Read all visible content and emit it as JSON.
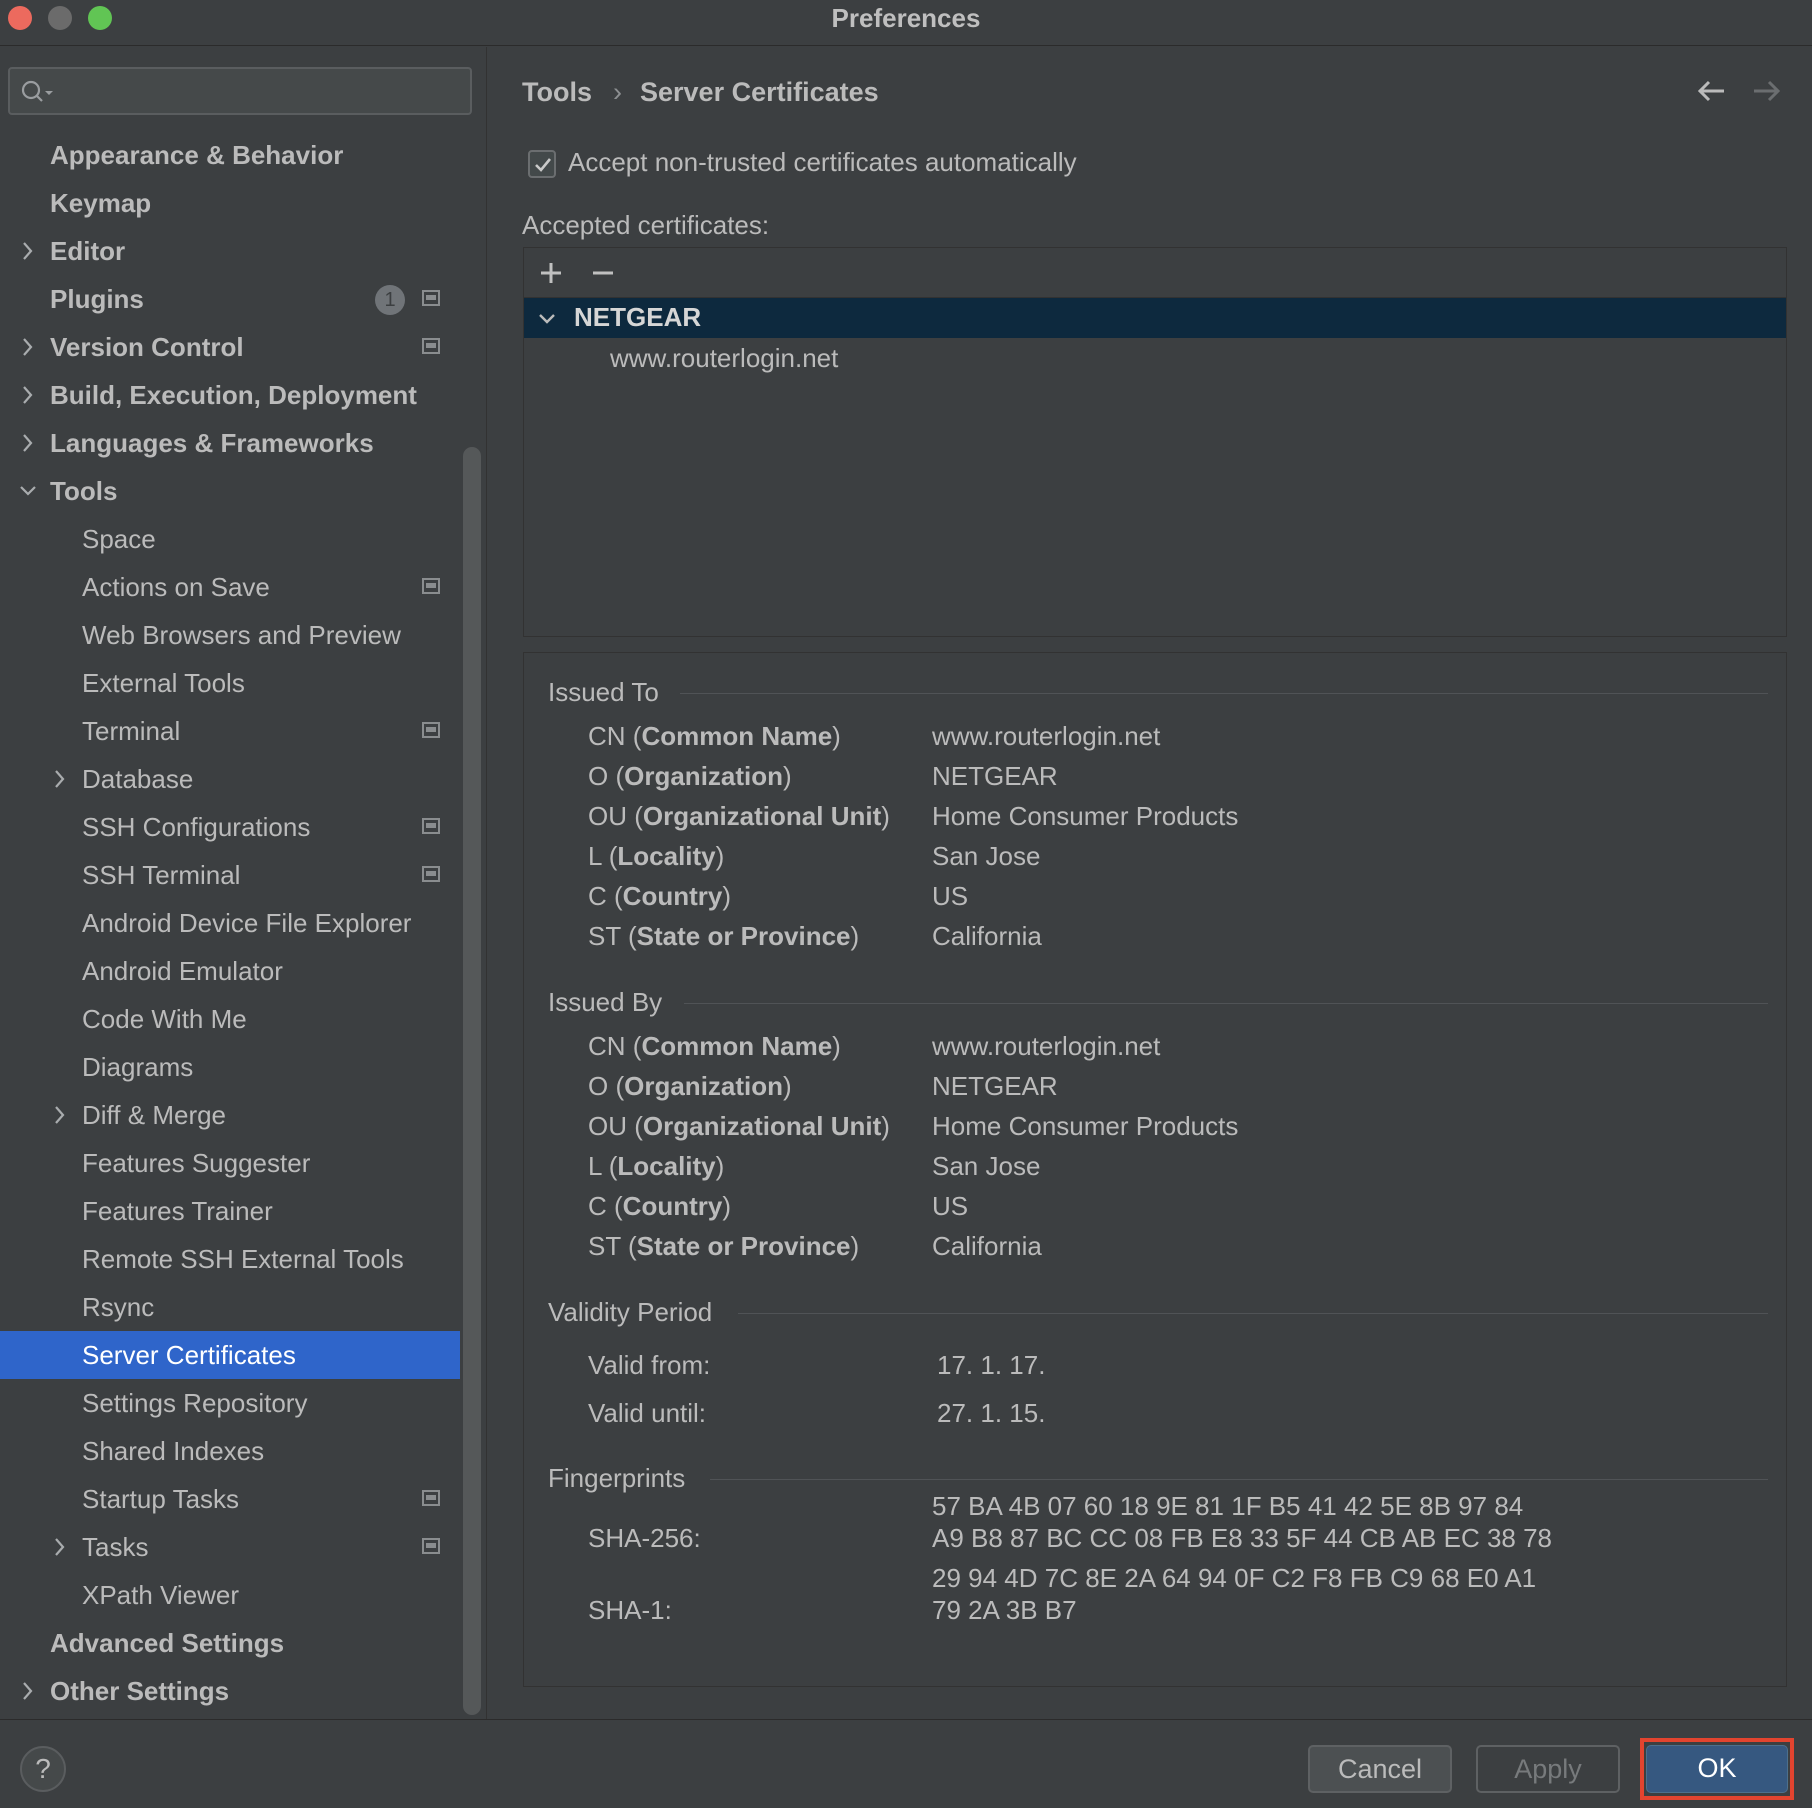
{
  "window": {
    "title": "Preferences"
  },
  "search": {
    "placeholder": ""
  },
  "sidebar": {
    "items": [
      {
        "label": "Appearance & Behavior",
        "bold": true,
        "expandable": false,
        "indent": 0
      },
      {
        "label": "Keymap",
        "bold": true,
        "expandable": false,
        "indent": 0
      },
      {
        "label": "Editor",
        "bold": true,
        "expandable": true,
        "expanded": false,
        "indent": 0
      },
      {
        "label": "Plugins",
        "bold": true,
        "expandable": false,
        "indent": 0,
        "badge": "1",
        "project": true
      },
      {
        "label": "Version Control",
        "bold": true,
        "expandable": true,
        "expanded": false,
        "indent": 0,
        "project": true
      },
      {
        "label": "Build, Execution, Deployment",
        "bold": true,
        "expandable": true,
        "expanded": false,
        "indent": 0
      },
      {
        "label": "Languages & Frameworks",
        "bold": true,
        "expandable": true,
        "expanded": false,
        "indent": 0
      },
      {
        "label": "Tools",
        "bold": true,
        "expandable": true,
        "expanded": true,
        "indent": 0
      },
      {
        "label": "Space",
        "indent": 1
      },
      {
        "label": "Actions on Save",
        "indent": 1,
        "project": true
      },
      {
        "label": "Web Browsers and Preview",
        "indent": 1
      },
      {
        "label": "External Tools",
        "indent": 1
      },
      {
        "label": "Terminal",
        "indent": 1,
        "project": true
      },
      {
        "label": "Database",
        "indent": 1,
        "expandable": true,
        "expanded": false
      },
      {
        "label": "SSH Configurations",
        "indent": 1,
        "project": true
      },
      {
        "label": "SSH Terminal",
        "indent": 1,
        "project": true
      },
      {
        "label": "Android Device File Explorer",
        "indent": 1
      },
      {
        "label": "Android Emulator",
        "indent": 1
      },
      {
        "label": "Code With Me",
        "indent": 1
      },
      {
        "label": "Diagrams",
        "indent": 1
      },
      {
        "label": "Diff & Merge",
        "indent": 1,
        "expandable": true,
        "expanded": false
      },
      {
        "label": "Features Suggester",
        "indent": 1
      },
      {
        "label": "Features Trainer",
        "indent": 1
      },
      {
        "label": "Remote SSH External Tools",
        "indent": 1
      },
      {
        "label": "Rsync",
        "indent": 1
      },
      {
        "label": "Server Certificates",
        "indent": 1,
        "selected": true
      },
      {
        "label": "Settings Repository",
        "indent": 1
      },
      {
        "label": "Shared Indexes",
        "indent": 1
      },
      {
        "label": "Startup Tasks",
        "indent": 1,
        "project": true
      },
      {
        "label": "Tasks",
        "indent": 1,
        "expandable": true,
        "expanded": false,
        "project": true
      },
      {
        "label": "XPath Viewer",
        "indent": 1
      },
      {
        "label": "Advanced Settings",
        "bold": true,
        "indent": 0
      },
      {
        "label": "Other Settings",
        "bold": true,
        "expandable": true,
        "expanded": false,
        "indent": 0
      }
    ]
  },
  "breadcrumb": {
    "parent": "Tools",
    "separator": "›",
    "current": "Server Certificates"
  },
  "accept_checkbox": {
    "label": "Accept non-trusted certificates automatically",
    "checked": true
  },
  "certificates": {
    "label": "Accepted certificates:",
    "add_icon": "plus-icon",
    "remove_icon": "minus-icon",
    "group": "NETGEAR",
    "entry": "www.routerlogin.net"
  },
  "issued_to": {
    "title": "Issued To",
    "rows": [
      {
        "abbr": "CN",
        "name": "Common Name",
        "value": "www.routerlogin.net"
      },
      {
        "abbr": "O",
        "name": "Organization",
        "value": "NETGEAR"
      },
      {
        "abbr": "OU",
        "name": "Organizational Unit",
        "value": "Home Consumer Products"
      },
      {
        "abbr": "L",
        "name": "Locality",
        "value": "San Jose"
      },
      {
        "abbr": "C",
        "name": "Country",
        "value": "US"
      },
      {
        "abbr": "ST",
        "name": "State or Province",
        "value": "California"
      }
    ]
  },
  "issued_by": {
    "title": "Issued By",
    "rows": [
      {
        "abbr": "CN",
        "name": "Common Name",
        "value": "www.routerlogin.net"
      },
      {
        "abbr": "O",
        "name": "Organization",
        "value": "NETGEAR"
      },
      {
        "abbr": "OU",
        "name": "Organizational Unit",
        "value": "Home Consumer Products"
      },
      {
        "abbr": "L",
        "name": "Locality",
        "value": "San Jose"
      },
      {
        "abbr": "C",
        "name": "Country",
        "value": "US"
      },
      {
        "abbr": "ST",
        "name": "State or Province",
        "value": "California"
      }
    ]
  },
  "validity": {
    "title": "Validity Period",
    "from_label": "Valid from:",
    "from": "17. 1. 17.",
    "until_label": "Valid until:",
    "until": "27. 1. 15."
  },
  "fingerprints": {
    "title": "Fingerprints",
    "sha256_label": "SHA-256:",
    "sha256_line1": "57 BA 4B 07 60 18 9E 81 1F B5 41 42 5E 8B 97 84",
    "sha256_line2": "A9 B8 87 BC CC 08 FB E8 33 5F 44 CB AB EC 38 78",
    "sha1_label": "SHA-1:",
    "sha1_line1": "29 94 4D 7C 8E 2A 64 94 0F C2 F8 FB C9 68 E0 A1",
    "sha1_line2": "79 2A 3B B7"
  },
  "footer": {
    "help": "?",
    "cancel": "Cancel",
    "apply": "Apply",
    "ok": "OK"
  },
  "colors": {
    "selection": "#2f65ca",
    "ok_button": "#365880",
    "highlight_box": "#e2442f",
    "tree_selection": "#0d293e"
  }
}
